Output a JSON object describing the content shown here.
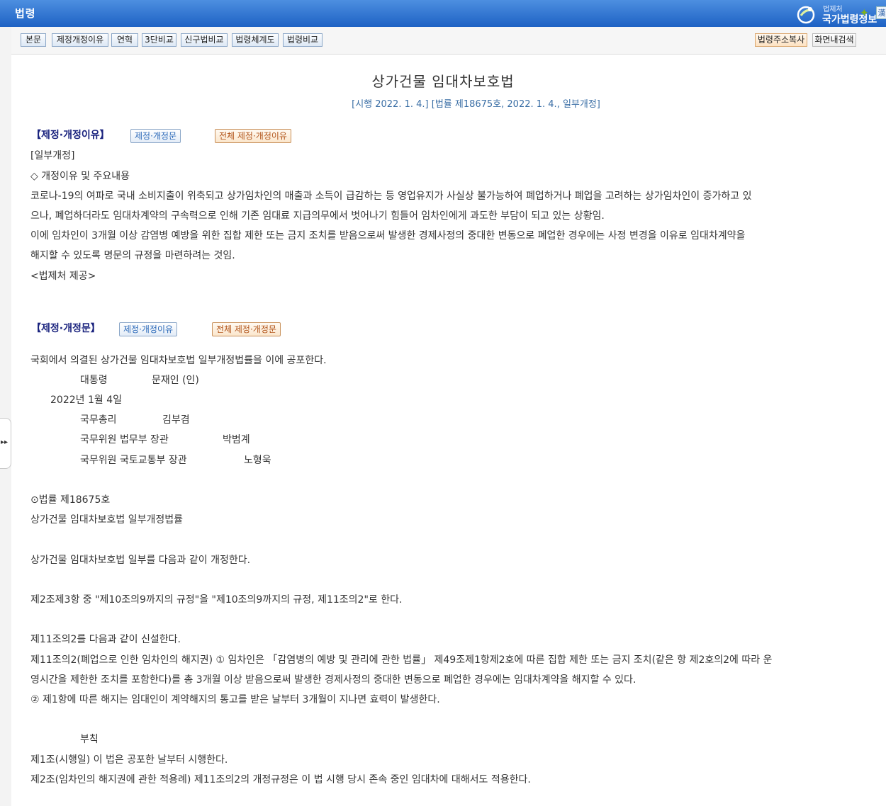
{
  "header": {
    "title": "법령",
    "brand_small": "법제처",
    "brand_big": "국가법령정보"
  },
  "toolbar": {
    "left_buttons": [
      "본문",
      "제정개정이유",
      "연혁",
      "3단비교",
      "신구법비교",
      "법령체계도",
      "법령비교"
    ],
    "copy_address": "법령주소복사",
    "search_in_page": "화면내검색",
    "lang_icon": "漢"
  },
  "document": {
    "title": "상가건물 임대차보호법",
    "subtitle": "[시행 2022. 1. 4.] [법률 제18675호, 2022. 1. 4., 일부개정]",
    "reason_section": {
      "heading": "【제정·개정이유】",
      "btn_text": "제정·개정문",
      "btn_all": "전체 제정·개정이유",
      "lines": [
        "[일부개정]",
        "◇ 개정이유 및 주요내용",
        "  코로나-19의 여파로 국내 소비지출이 위축되고 상가임차인의 매출과 소득이 급감하는 등 영업유지가 사실상 불가능하여 폐업하거나 폐업을 고려하는 상가임차인이 증가하고 있",
        "으나, 폐업하더라도 임대차계약의 구속력으로 인해 기존 임대료 지급의무에서 벗어나기 힘들어 임차인에게 과도한 부담이 되고 있는 상황임.",
        "  이에 임차인이 3개월 이상 감염병 예방을 위한 집합 제한 또는 금지 조치를 받음으로써 발생한 경제사정의 중대한 변동으로 폐업한 경우에는 사정 변경을 이유로 임대차계약을",
        "해지할 수 있도록 명문의 규정을 마련하려는 것임.",
        "<법제처 제공>"
      ]
    },
    "text_section": {
      "heading": "【제정·개정문】",
      "btn_reason": "제정·개정이유",
      "btn_all": "전체 제정·개정문",
      "promulgation": "국회에서 의결된 상가건물 임대차보호법 일부개정법률을 이에 공포한다.",
      "president_title": "대통령",
      "president_name": "문재인 (인)",
      "date": "2022년 1월 4일",
      "signers": [
        {
          "title": "국무총리",
          "name": "김부겸"
        },
        {
          "title": "국무위원 법무부 장관",
          "name": "박범계"
        },
        {
          "title": "국무위원 국토교통부 장관",
          "name": "노형욱"
        }
      ],
      "law_no": "⊙법률 제18675호",
      "law_name": "상가건물 임대차보호법 일부개정법률",
      "amend_intro": "상가건물 임대차보호법 일부를 다음과 같이 개정한다.",
      "art2": "제2조제3항 중 \"제10조의9까지의 규정\"을 \"제10조의9까지의 규정, 제11조의2\"로 한다.",
      "art11_intro": "제11조의2를 다음과 같이 신설한다.",
      "art11_line1": "제11조의2(폐업으로 인한 임차인의 해지권) ① 임차인은 「감염병의 예방 및 관리에 관한 법률」 제49조제1항제2호에 따른 집합 제한 또는 금지 조치(같은 항 제2호의2에 따라 운",
      "art11_line2": "영시간을 제한한 조치를 포함한다)를 총 3개월 이상 받음으로써 발생한 경제사정의 중대한 변동으로 폐업한 경우에는 임대차계약을 해지할 수 있다.",
      "art11_line3": "  ② 제1항에 따른 해지는 임대인이 계약해지의 통고를 받은 날부터 3개월이 지나면 효력이 발생한다.",
      "addenda_title": "부칙",
      "addenda_1": "제1조(시행일) 이 법은 공포한 날부터 시행한다.",
      "addenda_2": "제2조(임차인의 해지권에 관한 적용례) 제11조의2의 개정규정은 이 법 시행 당시 존속 중인 임대차에 대해서도 적용한다."
    }
  },
  "side_tab_icon": "double-chevron-right-icon"
}
